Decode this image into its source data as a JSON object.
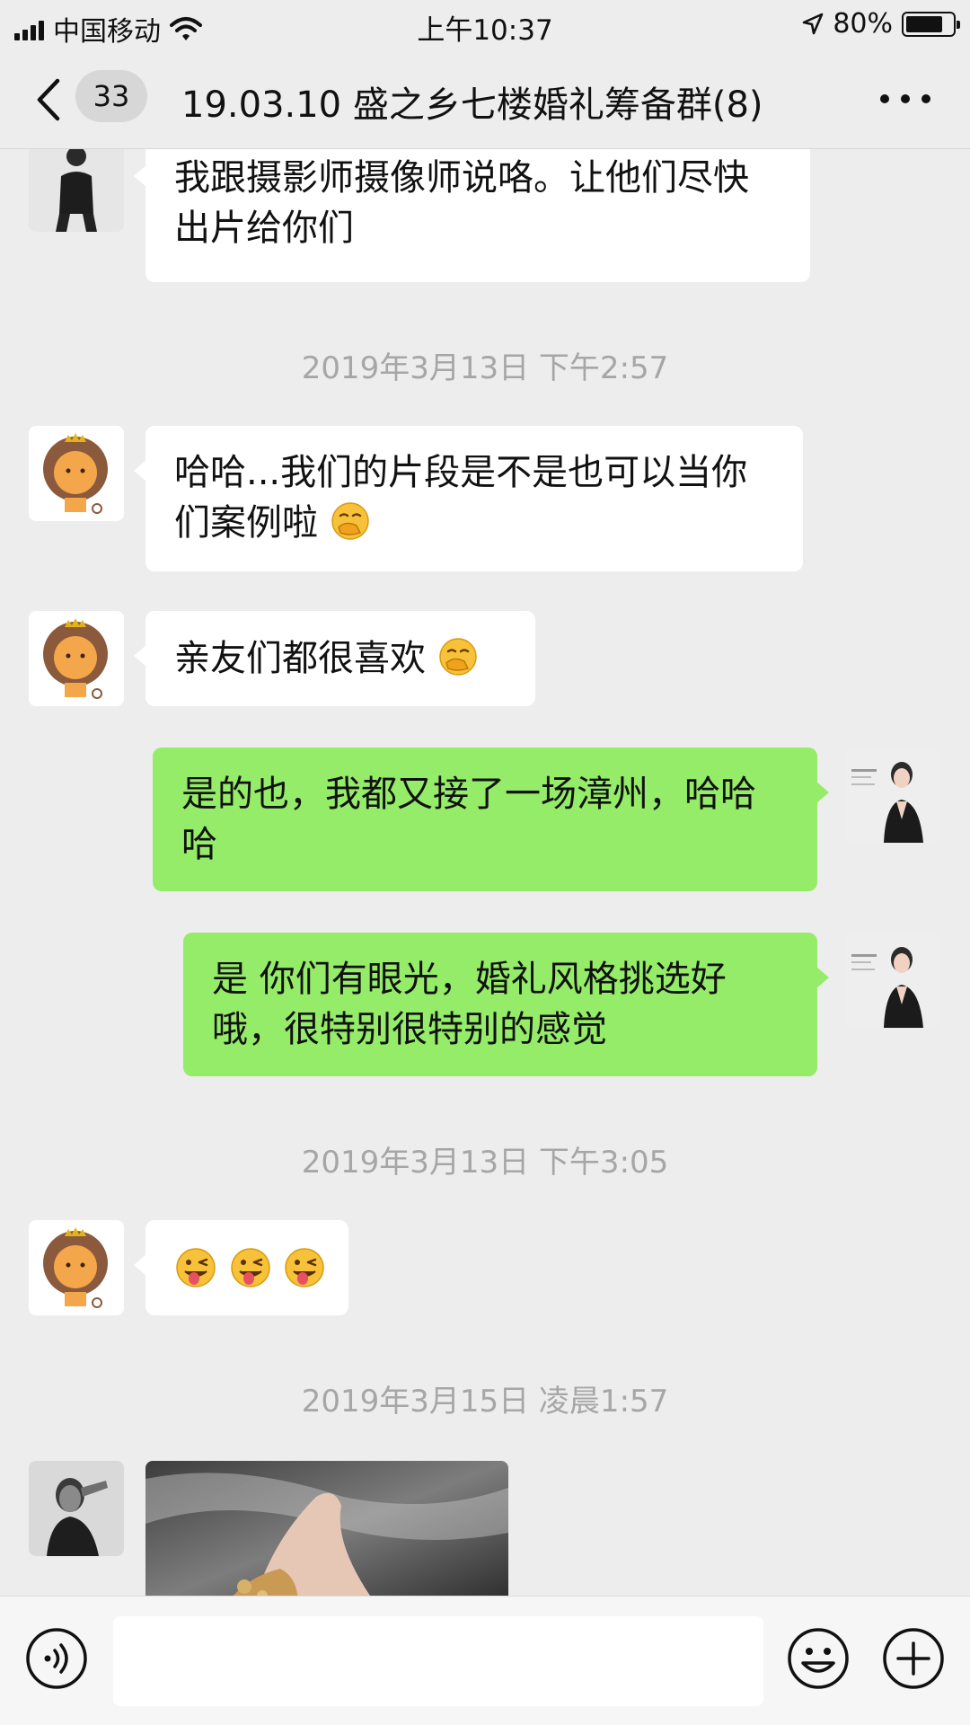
{
  "status_bar": {
    "carrier": "中国移动",
    "time": "上午10:37",
    "battery_percent": "80%",
    "battery_level": 0.8
  },
  "nav": {
    "back_count": "33",
    "title": "19.03.10 盛之乡七楼婚礼筹备群(8)"
  },
  "messages": [
    {
      "side": "left",
      "avatar": "woman-black-suit-avatar",
      "text": "我跟摄影师摄像师说咯。让他们尽快出片给你们"
    },
    {
      "timestamp": "2019年3月13日 下午2:57"
    },
    {
      "side": "left",
      "avatar": "lion-avatar",
      "text": "哈哈...我们的片段是不是也可以当你们案例啦",
      "emoji": "face-with-hand-over-mouth"
    },
    {
      "side": "left",
      "avatar": "lion-avatar",
      "text": "亲友们都很喜欢",
      "emoji": "face-with-hand-over-mouth"
    },
    {
      "side": "right",
      "avatar": "planner-avatar",
      "text": "是的也，我都又接了一场漳州，哈哈哈"
    },
    {
      "side": "right",
      "avatar": "planner-avatar",
      "text": "是 你们有眼光，婚礼风格挑选好哦，很特别很特别的感觉"
    },
    {
      "timestamp": "2019年3月13日 下午3:05"
    },
    {
      "side": "left",
      "avatar": "lion-avatar",
      "emoji": "winking-face-with-tongue ×3"
    },
    {
      "timestamp": "2019年3月15日 凌晨1:57"
    },
    {
      "side": "left",
      "avatar": "man-portrait-avatar",
      "image": "bridal-shoes-photo"
    }
  ],
  "input_bar": {
    "placeholder": "",
    "icons": [
      "voice-icon",
      "emoji-icon",
      "plus-icon"
    ]
  },
  "colors": {
    "background": "#ededed",
    "bubble_self": "#95ec69",
    "bubble_other": "#ffffff",
    "timestamp": "#a6a6a6"
  }
}
